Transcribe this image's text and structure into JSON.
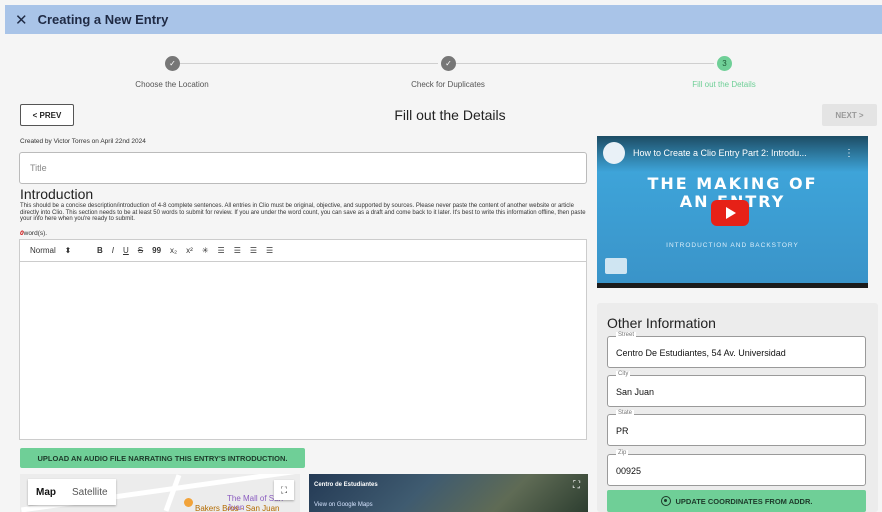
{
  "window": {
    "title": "Creating a New Entry",
    "close_glyph": "✕"
  },
  "stepper": {
    "steps": [
      {
        "label": "Choose the Location",
        "state": "done"
      },
      {
        "label": "Check for Duplicates",
        "state": "done"
      },
      {
        "label": "Fill out the Details",
        "state": "active",
        "number": "3"
      }
    ]
  },
  "nav": {
    "prev_label": "< PREV",
    "next_label": "NEXT >",
    "heading": "Fill out the Details"
  },
  "form": {
    "created_by": "Created by Victor Torres on April 22nd 2024",
    "title_placeholder": "Title",
    "intro_heading": "Introduction",
    "intro_description": "This should be a concise description/introduction of 4-8 complete sentences. All entries in Clio must be original, objective, and supported by sources. Please never paste the content of another website or article directly into Clio. This section needs to be at least 50 words to submit for review. If you are under the word count, you can save as a draft and come back to it later. It's best to write this information offline, then paste your info here when you're ready to submit.",
    "word_count": "0",
    "word_count_suffix": "word(s).",
    "toolbar": {
      "format": "Normal",
      "bold": "B",
      "italic": "I",
      "underline": "U",
      "strike": "S",
      "quote": "99",
      "sub": "x₂",
      "sup": "x²",
      "clean": "✳",
      "ol": "☰",
      "ul": "☰",
      "indent_in": "☰",
      "indent_out": "☰"
    },
    "upload_label": "UPLOAD AN AUDIO FILE NARRATING THIS ENTRY'S INTRODUCTION."
  },
  "map": {
    "toggle_map": "Map",
    "toggle_satellite": "Satellite",
    "place1": "The Mall of San Juan",
    "place2": "Bakers Bros - San Juan"
  },
  "streetview": {
    "place": "Centro de Estudiantes",
    "link": "View on Google Maps"
  },
  "video": {
    "title": "How to Create a Clio Entry Part 2: Introdu...",
    "line1": "THE MAKING OF",
    "line2": "AN ENTRY",
    "subtitle": "INTRODUCTION AND BACKSTORY"
  },
  "other_info": {
    "heading": "Other Information",
    "fields": [
      {
        "label": "Street",
        "value": "Centro De Estudiantes, 54 Av. Universidad"
      },
      {
        "label": "City",
        "value": "San Juan"
      },
      {
        "label": "State",
        "value": "PR"
      },
      {
        "label": "Zip",
        "value": "00925"
      }
    ],
    "update_label": "UPDATE COORDINATES FROM ADDR."
  },
  "colors": {
    "accent": "#6fcf97",
    "titlebar": "#a9c4e8",
    "youtube_red": "#e62117"
  }
}
